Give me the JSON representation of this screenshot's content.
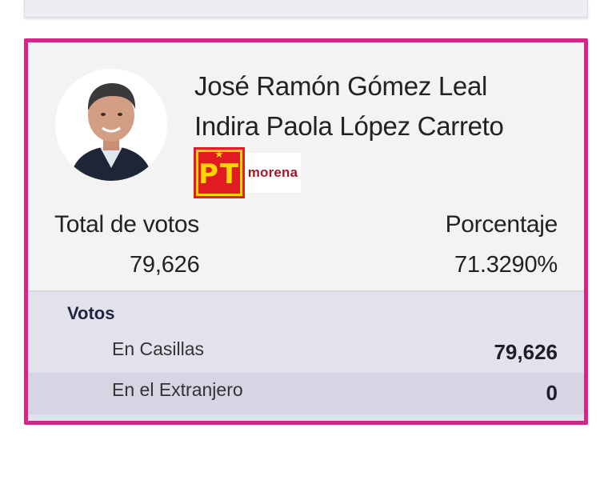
{
  "candidate": {
    "name_primary": "José Ramón Gómez Leal",
    "name_substitute": "Indira Paola López Carreto",
    "parties": {
      "pt_logo_text": "PT",
      "morena_logo_text": "morena"
    }
  },
  "totals": {
    "total_label": "Total de votos",
    "total_value": "79,626",
    "percent_label": "Porcentaje",
    "percent_value": "71.3290%"
  },
  "votes_breakdown": {
    "title": "Votos",
    "rows": [
      {
        "label": "En Casillas",
        "value": "79,626"
      },
      {
        "label": "En el Extranjero",
        "value": "0"
      }
    ]
  },
  "colors": {
    "card_border": "#d6258a",
    "pt_red": "#e11b22",
    "pt_yellow": "#ffd400",
    "morena_maroon": "#a3192a"
  }
}
